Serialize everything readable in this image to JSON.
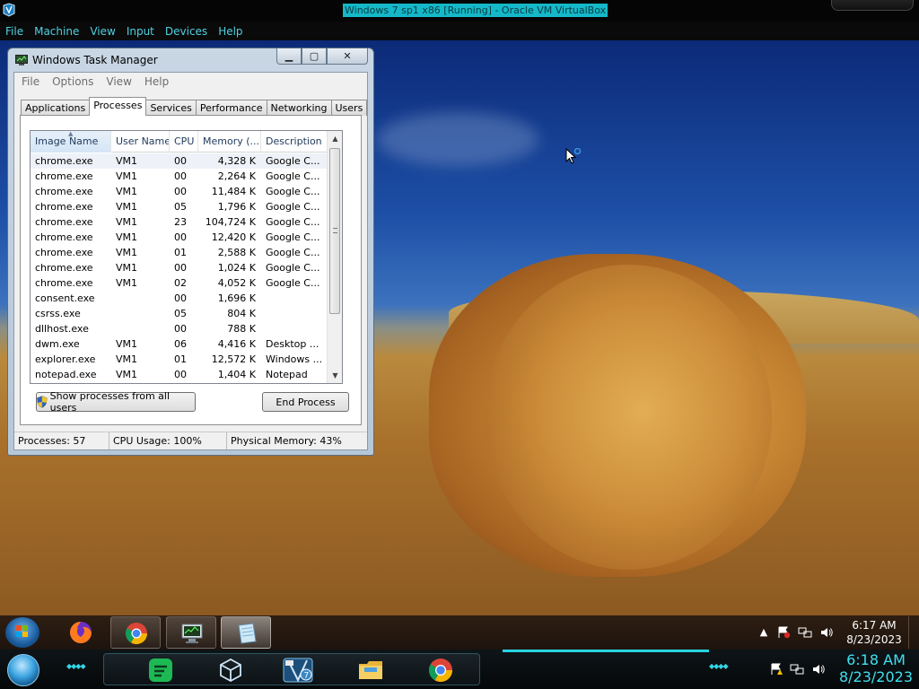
{
  "host": {
    "window_title": "Windows 7 sp1 x86 [Running] - Oracle VM VirtualBox",
    "menu": [
      "File",
      "Machine",
      "View",
      "Input",
      "Devices",
      "Help"
    ],
    "clock_time": "6:18 AM",
    "clock_date": "8/23/2023",
    "accent_color": "#27d3e3"
  },
  "task_manager": {
    "title": "Windows Task Manager",
    "menu": [
      "File",
      "Options",
      "View",
      "Help"
    ],
    "tabs": [
      "Applications",
      "Processes",
      "Services",
      "Performance",
      "Networking",
      "Users"
    ],
    "active_tab": "Processes",
    "columns": [
      "Image Name",
      "User Name",
      "CPU",
      "Memory (...",
      "Description"
    ],
    "sort_indicator": "▲",
    "rows": [
      {
        "name": "chrome.exe",
        "user": "VM1",
        "cpu": "00",
        "mem": "4,328 K",
        "desc": "Google C..."
      },
      {
        "name": "chrome.exe",
        "user": "VM1",
        "cpu": "00",
        "mem": "2,264 K",
        "desc": "Google C..."
      },
      {
        "name": "chrome.exe",
        "user": "VM1",
        "cpu": "00",
        "mem": "11,484 K",
        "desc": "Google C..."
      },
      {
        "name": "chrome.exe",
        "user": "VM1",
        "cpu": "05",
        "mem": "1,796 K",
        "desc": "Google C..."
      },
      {
        "name": "chrome.exe",
        "user": "VM1",
        "cpu": "23",
        "mem": "104,724 K",
        "desc": "Google C..."
      },
      {
        "name": "chrome.exe",
        "user": "VM1",
        "cpu": "00",
        "mem": "12,420 K",
        "desc": "Google C..."
      },
      {
        "name": "chrome.exe",
        "user": "VM1",
        "cpu": "01",
        "mem": "2,588 K",
        "desc": "Google C..."
      },
      {
        "name": "chrome.exe",
        "user": "VM1",
        "cpu": "00",
        "mem": "1,024 K",
        "desc": "Google C..."
      },
      {
        "name": "chrome.exe",
        "user": "VM1",
        "cpu": "02",
        "mem": "4,052 K",
        "desc": "Google C..."
      },
      {
        "name": "consent.exe",
        "user": "",
        "cpu": "00",
        "mem": "1,696 K",
        "desc": ""
      },
      {
        "name": "csrss.exe",
        "user": "",
        "cpu": "05",
        "mem": "804 K",
        "desc": ""
      },
      {
        "name": "dllhost.exe",
        "user": "",
        "cpu": "00",
        "mem": "788 K",
        "desc": ""
      },
      {
        "name": "dwm.exe",
        "user": "VM1",
        "cpu": "06",
        "mem": "4,416 K",
        "desc": "Desktop ..."
      },
      {
        "name": "explorer.exe",
        "user": "VM1",
        "cpu": "01",
        "mem": "12,572 K",
        "desc": "Windows ..."
      },
      {
        "name": "notepad.exe",
        "user": "VM1",
        "cpu": "00",
        "mem": "1,404 K",
        "desc": "Notepad"
      }
    ],
    "show_all_button": "Show processes from all users",
    "end_process_button": "End Process",
    "status": {
      "processes": "Processes: 57",
      "cpu": "CPU Usage: 100%",
      "memory": "Physical Memory: 43%"
    }
  },
  "guest_taskbar": {
    "clock_time": "6:17 AM",
    "clock_date": "8/23/2023"
  }
}
